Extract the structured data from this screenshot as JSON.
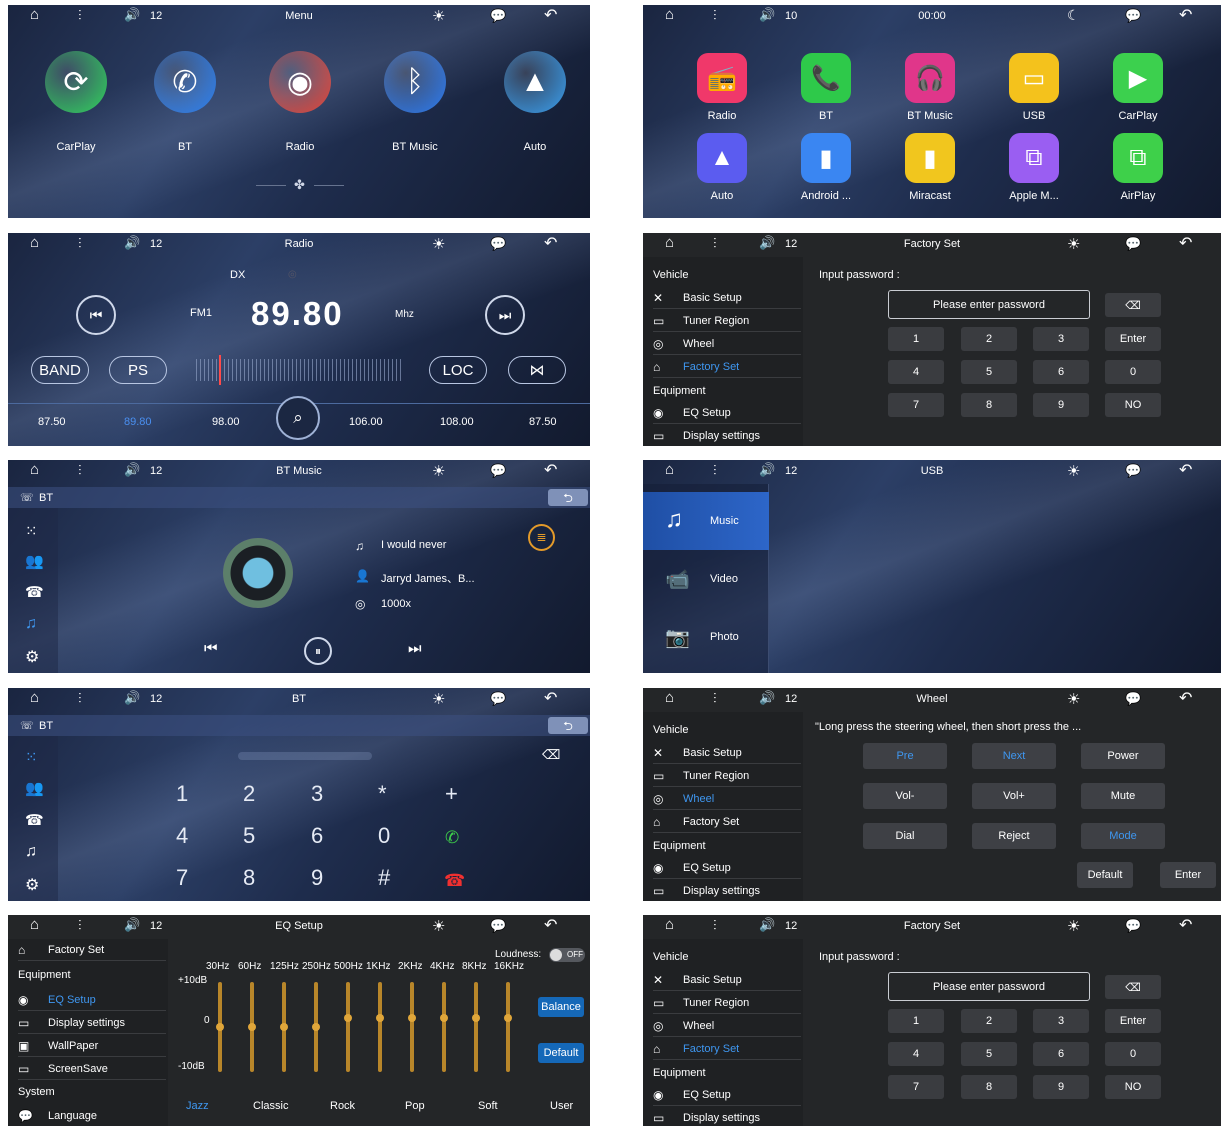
{
  "status": {
    "home": "⌂",
    "eq": "⫶",
    "vol": "🔊",
    "sun": "☀",
    "msg": "💬",
    "back": "↶"
  },
  "p1": {
    "title": "Menu",
    "vol": "12",
    "items": [
      {
        "label": "CarPlay",
        "color": "#2fd15a"
      },
      {
        "label": "BT",
        "color": "#2a7ff0"
      },
      {
        "label": "Radio",
        "color": "#e8473a"
      },
      {
        "label": "BT Music",
        "color": "#2f7ef5"
      },
      {
        "label": "Auto",
        "color": "#3aa0f0"
      }
    ]
  },
  "p2": {
    "title": "00:00",
    "vol": "10",
    "apps": [
      {
        "label": "Radio",
        "color": "#f0386a",
        "glyph": "📻"
      },
      {
        "label": "BT",
        "color": "#2ec94a",
        "glyph": "📞"
      },
      {
        "label": "BT Music",
        "color": "#e0368a",
        "glyph": "🎧"
      },
      {
        "label": "USB",
        "color": "#f4c21c",
        "glyph": "▭"
      },
      {
        "label": "CarPlay",
        "color": "#3cd04e",
        "glyph": "▶"
      },
      {
        "label": "Auto",
        "color": "#5b5cf0",
        "glyph": "▲"
      },
      {
        "label": "Android ...",
        "color": "#3a86f2",
        "glyph": "▮"
      },
      {
        "label": "Miracast",
        "color": "#f1c61e",
        "glyph": "▮"
      },
      {
        "label": "Apple M...",
        "color": "#9a5ef2",
        "glyph": "⧉"
      },
      {
        "label": "AirPlay",
        "color": "#3ed04a",
        "glyph": "⧉"
      }
    ]
  },
  "p3": {
    "title": "Radio",
    "vol": "12",
    "dx": "DX",
    "band": "FM1",
    "freq": "89.80",
    "unit": "Mhz",
    "buttons": {
      "band": "BAND",
      "ps": "PS",
      "loc": "LOC"
    },
    "presets": [
      "87.50",
      "89.80",
      "98.00",
      "106.00",
      "108.00",
      "87.50"
    ]
  },
  "p4": {
    "title": "Factory Set",
    "vol": "12",
    "vehicle": "Vehicle",
    "equipment": "Equipment",
    "menu": [
      "Basic Setup",
      "Tuner Region",
      "Wheel",
      "Factory Set"
    ],
    "menu2": [
      "EQ Setup",
      "Display settings"
    ],
    "input_label": "Input password :",
    "placeholder": "Please enter password",
    "keys": [
      "1",
      "2",
      "3",
      "4",
      "5",
      "6",
      "7",
      "8",
      "9"
    ],
    "side": [
      "Enter",
      "0",
      "NO"
    ]
  },
  "p5": {
    "title": "BT Music",
    "vol": "12",
    "bt": "BT",
    "song": "I would never",
    "artist": "Jarryd James、B...",
    "album": "1000x"
  },
  "p6": {
    "title": "USB",
    "vol": "12",
    "tabs": [
      "Music",
      "Video",
      "Photo"
    ]
  },
  "p7": {
    "title": "BT",
    "vol": "12",
    "bt": "BT",
    "keys": [
      "1",
      "2",
      "3",
      "*",
      "+",
      "4",
      "5",
      "6",
      "0",
      "",
      "7",
      "8",
      "9",
      "#",
      ""
    ]
  },
  "p8": {
    "title": "Wheel",
    "vol": "12",
    "vehicle": "Vehicle",
    "equipment": "Equipment",
    "menu": [
      "Basic Setup",
      "Tuner Region",
      "Wheel",
      "Factory Set"
    ],
    "menu2": [
      "EQ Setup",
      "Display settings"
    ],
    "hint": "\"Long press the steering wheel, then short press the ...",
    "buttons": [
      "Pre",
      "Next",
      "Power",
      "Vol-",
      "Vol+",
      "Mute",
      "Dial",
      "Reject",
      "Mode"
    ],
    "default": "Default",
    "enter": "Enter"
  },
  "p9": {
    "title": "EQ Setup",
    "vol": "12",
    "factory": "Factory Set",
    "equipment": "Equipment",
    "menu": [
      "EQ Setup",
      "Display settings",
      "WallPaper",
      "ScreenSave"
    ],
    "system": "System",
    "language": "Language",
    "loudness": "Loudness:",
    "off": "OFF",
    "freqs": [
      "30Hz",
      "60Hz",
      "125Hz",
      "250Hz",
      "500Hz",
      "1KHz",
      "2KHz",
      "4KHz",
      "8KHz",
      "16KHz"
    ],
    "db": [
      "+10dB",
      "0",
      "-10dB"
    ],
    "levels": [
      0.0,
      0.0,
      0.0,
      0.0,
      0.2,
      0.2,
      0.2,
      0.2,
      0.2,
      0.2
    ],
    "balance": "Balance",
    "default": "Default",
    "presets": [
      "Jazz",
      "Classic",
      "Rock",
      "Pop",
      "Soft",
      "User"
    ]
  },
  "p10": {
    "title": "Factory Set",
    "vol": "12",
    "vehicle": "Vehicle",
    "equipment": "Equipment",
    "menu": [
      "Basic Setup",
      "Tuner Region",
      "Wheel",
      "Factory Set"
    ],
    "menu2": [
      "EQ Setup",
      "Display settings"
    ],
    "input_label": "Input password :",
    "placeholder": "Please enter password",
    "keys": [
      "1",
      "2",
      "3",
      "4",
      "5",
      "6",
      "7",
      "8",
      "9"
    ],
    "side": [
      "Enter",
      "0",
      "NO"
    ]
  }
}
